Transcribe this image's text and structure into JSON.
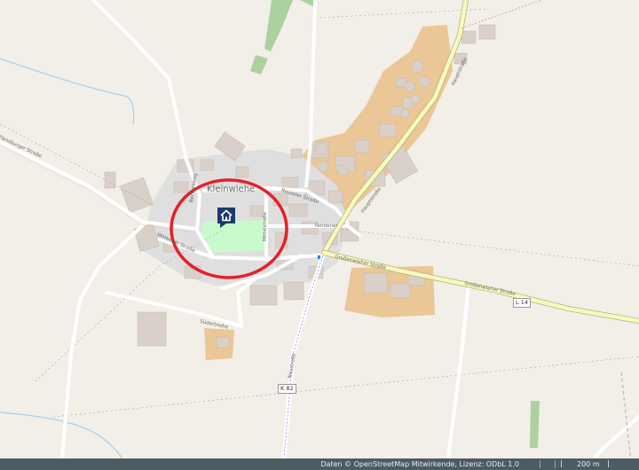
{
  "map": {
    "place_name": "Kleinwiehe",
    "streets": {
      "flensburger_strasse_nw": "Flensburger Straße",
      "wittbeker_strasse": "Wittbeker Straße",
      "suedertreihe": "Südertreihe",
      "reuseler_strasse": "Reuseler Straße",
      "norden_strasse": "Nordener",
      "beckerweg": "Beckersweg",
      "hauptstrasse_pl": "Hauptstraße",
      "mittel_strasse": "Mittelstraße",
      "haupt_strasse_ne": "Hauptstraße",
      "grossenwieher_1": "Großenwieher Straße",
      "grossenwieher_2": "Großenwieher Straße",
      "neustrasse": "Neustraße"
    },
    "road_refs": {
      "k82": "K 82",
      "l14": "L 14"
    },
    "marker_icon": "house-marker-icon",
    "highlight_color": "#e4202a",
    "marker_color": "#1b3a6b"
  },
  "footer": {
    "attribution": "Daten © OpenStreetMap Mitwirkende, Lizenz: ODbL 1.0",
    "scale_label": "200 m"
  }
}
